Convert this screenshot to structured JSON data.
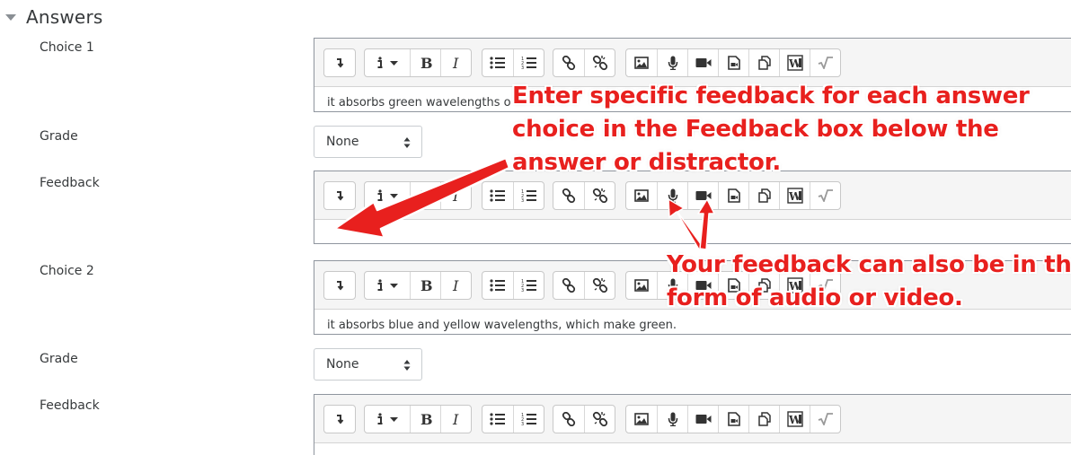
{
  "section": {
    "title": "Answers"
  },
  "choice1": {
    "label": "Choice 1",
    "text": "it absorbs green wavelengths o"
  },
  "grade1": {
    "label": "Grade",
    "value": "None"
  },
  "feedback1": {
    "label": "Feedback",
    "text": ""
  },
  "choice2": {
    "label": "Choice 2",
    "text": "it absorbs blue and yellow wavelengths, which make green."
  },
  "grade2": {
    "label": "Grade",
    "value": "None"
  },
  "feedback2": {
    "label": "Feedback",
    "text": ""
  },
  "annotations": {
    "feedback_line1": "Enter specific feedback for each answer",
    "feedback_line2": "choice in the Feedback box below the",
    "feedback_line3": "answer or distractor.",
    "media_line1": "Your feedback can also be in the",
    "media_line2": "form of audio or video."
  },
  "toolbar_icons": [
    "collapse-icon",
    "paragraph-style-icon",
    "bold-icon",
    "italic-icon",
    "unordered-list-icon",
    "ordered-list-icon",
    "link-icon",
    "unlink-icon",
    "image-icon",
    "record-audio-icon",
    "record-video-icon",
    "media-icon",
    "manage-files-icon",
    "word-import-icon",
    "equation-icon"
  ],
  "colors": {
    "annotation": "#e8201e",
    "toolbar_bg": "#f5f5f5",
    "border": "#8f959e"
  }
}
